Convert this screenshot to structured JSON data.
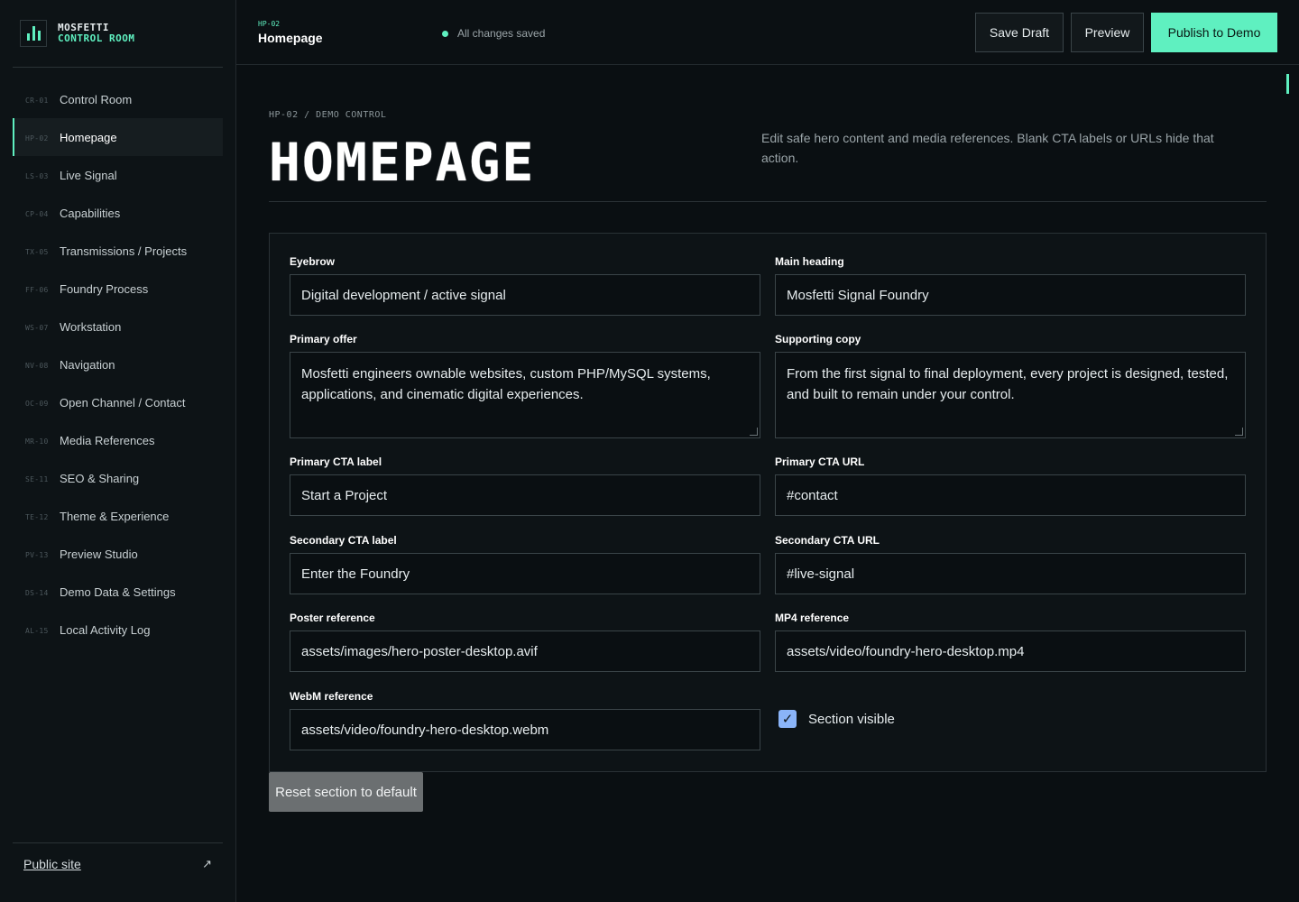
{
  "brand": {
    "line1": "MOSFETTI",
    "line2": "CONTROL ROOM",
    "accent": "#5ff0c0"
  },
  "sidebar": {
    "items": [
      {
        "code": "CR-01",
        "label": "Control Room"
      },
      {
        "code": "HP-02",
        "label": "Homepage",
        "active": true
      },
      {
        "code": "LS-03",
        "label": "Live Signal"
      },
      {
        "code": "CP-04",
        "label": "Capabilities"
      },
      {
        "code": "TX-05",
        "label": "Transmissions / Projects"
      },
      {
        "code": "FF-06",
        "label": "Foundry Process"
      },
      {
        "code": "WS-07",
        "label": "Workstation"
      },
      {
        "code": "NV-08",
        "label": "Navigation"
      },
      {
        "code": "OC-09",
        "label": "Open Channel / Contact"
      },
      {
        "code": "MR-10",
        "label": "Media References"
      },
      {
        "code": "SE-11",
        "label": "SEO & Sharing"
      },
      {
        "code": "TE-12",
        "label": "Theme & Experience"
      },
      {
        "code": "PV-13",
        "label": "Preview Studio"
      },
      {
        "code": "DS-14",
        "label": "Demo Data & Settings"
      },
      {
        "code": "AL-15",
        "label": "Local Activity Log"
      }
    ],
    "footer_link": "Public site",
    "footer_icon": "external-link-icon"
  },
  "topbar": {
    "code": "HP-02",
    "title": "Homepage",
    "status": "All changes saved",
    "save_label": "Save Draft",
    "preview_label": "Preview",
    "publish_label": "Publish to Demo"
  },
  "page": {
    "eyebrow": "HP-02 / DEMO CONTROL",
    "title": "HOMEPAGE",
    "description": "Edit safe hero content and media references. Blank CTA labels or URLs hide that action."
  },
  "form": {
    "eyebrow": {
      "label": "Eyebrow",
      "value": "Digital development / active signal"
    },
    "main_heading": {
      "label": "Main heading",
      "value": "Mosfetti Signal Foundry"
    },
    "primary_offer": {
      "label": "Primary offer",
      "value": "Mosfetti engineers ownable websites, custom PHP/MySQL systems, applications, and cinematic digital experiences."
    },
    "supporting_copy": {
      "label": "Supporting copy",
      "value": "From the first signal to final deployment, every project is designed, tested, and built to remain under your control."
    },
    "primary_cta_label": {
      "label": "Primary CTA label",
      "value": "Start a Project"
    },
    "primary_cta_url": {
      "label": "Primary CTA URL",
      "value": "#contact"
    },
    "secondary_cta_label": {
      "label": "Secondary CTA label",
      "value": "Enter the Foundry"
    },
    "secondary_cta_url": {
      "label": "Secondary CTA URL",
      "value": "#live-signal"
    },
    "poster_ref": {
      "label": "Poster reference",
      "value": "assets/images/hero-poster-desktop.avif"
    },
    "mp4_ref": {
      "label": "MP4 reference",
      "value": "assets/video/foundry-hero-desktop.mp4"
    },
    "webm_ref": {
      "label": "WebM reference",
      "value": "assets/video/foundry-hero-desktop.webm"
    },
    "section_visible": {
      "label": "Section visible",
      "checked": true
    },
    "reset_label": "Reset section to default"
  }
}
